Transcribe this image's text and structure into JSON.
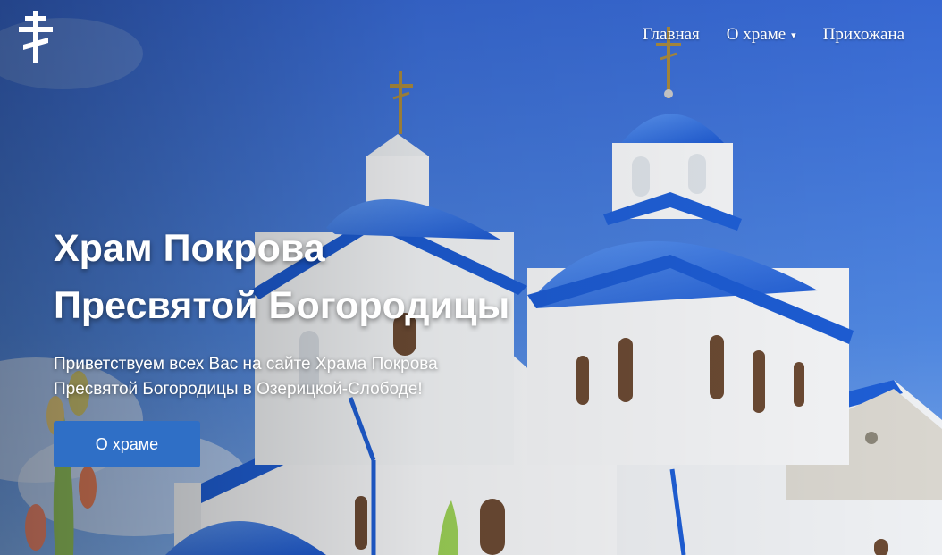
{
  "logo": {
    "icon": "orthodox-cross-icon"
  },
  "nav": {
    "items": [
      {
        "label": "Главная",
        "has_dropdown": false
      },
      {
        "label": "О храме",
        "has_dropdown": true
      },
      {
        "label": "Прихожана",
        "has_dropdown": false
      }
    ],
    "dropdown_icon": "▾"
  },
  "hero": {
    "title_line1": "Храм Покрова",
    "title_line2": "Пресвятой Богородицы",
    "subtitle": "Приветствуем всех Вас на сайте Храма Покрова Пресвятой Богородицы в Озерицкой-Слободе!",
    "button_label": "О храме"
  },
  "colors": {
    "sky": "#3f73d6",
    "dome": "#2e6fe0",
    "walls": "#f2f4f6",
    "button": "#2f6fc6"
  }
}
